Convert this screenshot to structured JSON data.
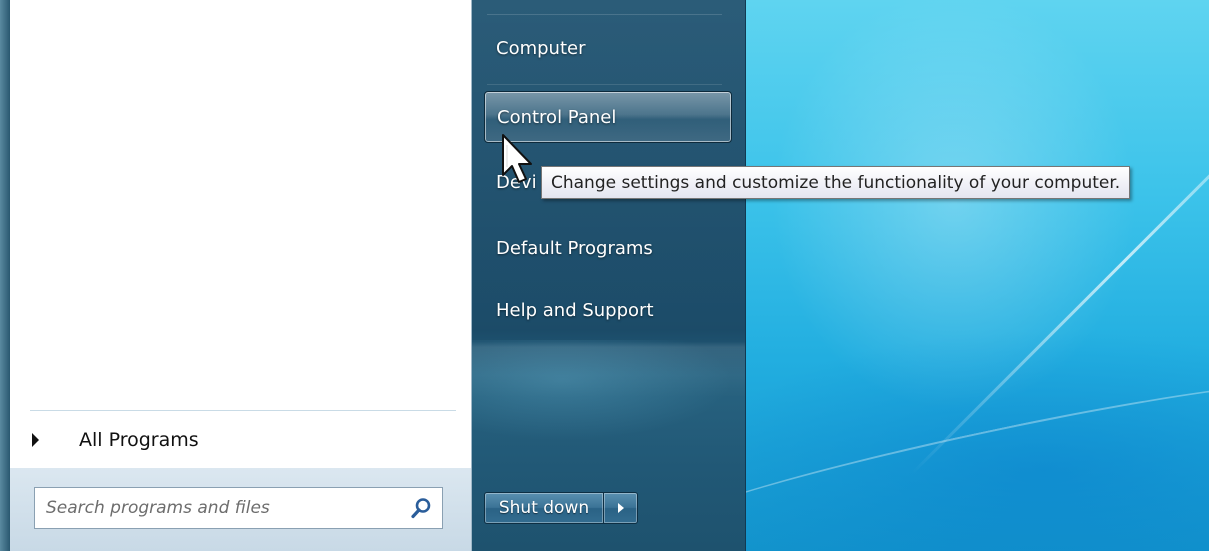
{
  "start_menu": {
    "all_programs_label": "All Programs",
    "search": {
      "placeholder": "Search programs and files",
      "value": ""
    },
    "right_items": [
      {
        "label": "Computer"
      },
      {
        "label": "Control Panel"
      },
      {
        "label": "Devi"
      },
      {
        "label": "Default Programs"
      },
      {
        "label": "Help and Support"
      }
    ],
    "shutdown_label": "Shut down",
    "hovered_item": "Control Panel"
  },
  "tooltip": {
    "text": "Change settings and customize the functionality of your computer."
  },
  "icons": {
    "search": "search-icon",
    "all_programs_arrow": "triangle-right-icon",
    "shutdown_options": "triangle-right-icon",
    "cursor": "arrow-cursor-icon"
  },
  "colors": {
    "right_pane": "#1e5270",
    "left_pane": "#ffffff",
    "desktop": "#3cc3ea",
    "tooltip_bg": "#ffffff"
  }
}
